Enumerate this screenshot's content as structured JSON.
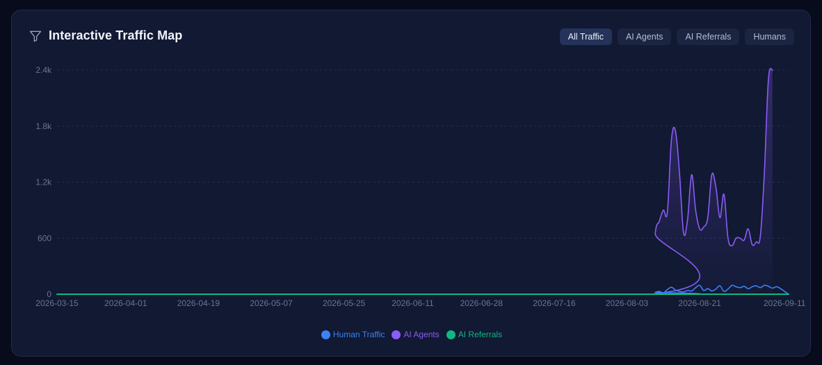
{
  "header": {
    "title": "Interactive Traffic Map",
    "icon": "filter-icon"
  },
  "tabs": [
    {
      "label": "All Traffic",
      "active": true
    },
    {
      "label": "AI Agents",
      "active": false
    },
    {
      "label": "AI Referrals",
      "active": false
    },
    {
      "label": "Humans",
      "active": false
    }
  ],
  "colors": {
    "human": "#3b82f6",
    "agents": "#8b5cf6",
    "referrals": "#10b981"
  },
  "chart_data": {
    "type": "area",
    "x_start": "2026-03-15",
    "x_end": "2026-09-12",
    "xticks": [
      "2026-03-15",
      "2026-04-01",
      "2026-04-19",
      "2026-05-07",
      "2026-05-25",
      "2026-06-11",
      "2026-06-28",
      "2026-07-16",
      "2026-08-03",
      "2026-08-21",
      "2026-09-11"
    ],
    "yticks": [
      0,
      600,
      1200,
      1800,
      2400
    ],
    "ytick_labels": [
      "0",
      "600",
      "1.2k",
      "1.8k",
      "2.4k"
    ],
    "ylim": [
      0,
      2400
    ],
    "grid": true,
    "legend_position": "bottom",
    "series": [
      {
        "name": "Human Traffic",
        "color": "#3b82f6",
        "points": [
          [
            "2026-03-15",
            0
          ],
          [
            "2026-08-09",
            0
          ],
          [
            "2026-08-10",
            20
          ],
          [
            "2026-08-11",
            30
          ],
          [
            "2026-08-12",
            15
          ],
          [
            "2026-08-13",
            50
          ],
          [
            "2026-08-14",
            75
          ],
          [
            "2026-08-15",
            45
          ],
          [
            "2026-08-16",
            30
          ],
          [
            "2026-08-17",
            25
          ],
          [
            "2026-08-18",
            40
          ],
          [
            "2026-08-19",
            35
          ],
          [
            "2026-08-20",
            70
          ],
          [
            "2026-08-21",
            95
          ],
          [
            "2026-08-22",
            40
          ],
          [
            "2026-08-23",
            60
          ],
          [
            "2026-08-24",
            35
          ],
          [
            "2026-08-25",
            55
          ],
          [
            "2026-08-26",
            90
          ],
          [
            "2026-08-27",
            30
          ],
          [
            "2026-08-28",
            55
          ],
          [
            "2026-08-29",
            95
          ],
          [
            "2026-08-30",
            80
          ],
          [
            "2026-08-31",
            70
          ],
          [
            "2026-09-01",
            85
          ],
          [
            "2026-09-02",
            60
          ],
          [
            "2026-09-03",
            80
          ],
          [
            "2026-09-04",
            90
          ],
          [
            "2026-09-05",
            70
          ],
          [
            "2026-09-06",
            95
          ],
          [
            "2026-09-07",
            85
          ],
          [
            "2026-09-08",
            65
          ],
          [
            "2026-09-09",
            80
          ],
          [
            "2026-09-10",
            60
          ],
          [
            "2026-09-11",
            30
          ],
          [
            "2026-09-12",
            0
          ]
        ]
      },
      {
        "name": "AI Agents",
        "color": "#8b5cf6",
        "points": [
          [
            "2026-03-15",
            0
          ],
          [
            "2026-08-09",
            0
          ],
          [
            "2026-08-10",
            650
          ],
          [
            "2026-08-11",
            780
          ],
          [
            "2026-08-12",
            900
          ],
          [
            "2026-08-13",
            880
          ],
          [
            "2026-08-14",
            1650
          ],
          [
            "2026-08-15",
            1750
          ],
          [
            "2026-08-16",
            1300
          ],
          [
            "2026-08-17",
            660
          ],
          [
            "2026-08-18",
            800
          ],
          [
            "2026-08-19",
            1280
          ],
          [
            "2026-08-20",
            900
          ],
          [
            "2026-08-21",
            700
          ],
          [
            "2026-08-22",
            720
          ],
          [
            "2026-08-23",
            820
          ],
          [
            "2026-08-24",
            1280
          ],
          [
            "2026-08-25",
            1150
          ],
          [
            "2026-08-26",
            820
          ],
          [
            "2026-08-27",
            1070
          ],
          [
            "2026-08-28",
            600
          ],
          [
            "2026-08-29",
            520
          ],
          [
            "2026-08-30",
            600
          ],
          [
            "2026-08-31",
            600
          ],
          [
            "2026-09-01",
            580
          ],
          [
            "2026-09-02",
            700
          ],
          [
            "2026-09-03",
            530
          ],
          [
            "2026-09-04",
            560
          ],
          [
            "2026-09-05",
            620
          ],
          [
            "2026-09-06",
            1300
          ],
          [
            "2026-09-07",
            2300
          ],
          [
            "2026-09-08",
            2400
          ]
        ]
      },
      {
        "name": "AI Referrals",
        "color": "#10b981",
        "points": [
          [
            "2026-03-15",
            0
          ],
          [
            "2026-09-12",
            0
          ]
        ]
      }
    ]
  }
}
